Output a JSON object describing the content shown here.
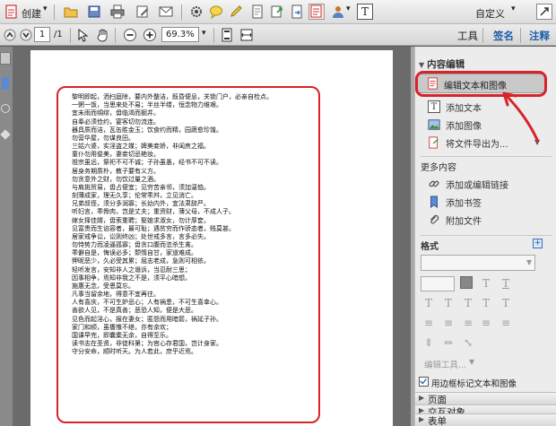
{
  "toolbar": {
    "create_label": "创建",
    "customize_label": "自定义",
    "page_current": "1",
    "page_total": "/1",
    "zoom": "69.3%",
    "tabs": [
      "工具",
      "签名",
      "注释"
    ]
  },
  "document": {
    "lines": [
      "黎明即起，洒扫庭除，要内外整洁，既昏便息，关锁门户，必亲自检点。",
      "一粥一饭，当思来处不易；半丝半缕，恒念物力维艰。",
      "宜未雨而绸缪，毋临渴而掘井。",
      "自奉必须俭约，宴客切勿流连。",
      "器具质而洁，瓦缶胜金玉；饮食约而精，园蔬愈珍馐。",
      "勿营华屋，勿谋良田。",
      "三姑六婆，实淫盗之媒；婢美妾娇，非闺房之福。",
      "童仆勿用俊美，妻妾切忌艳妆。",
      "祖宗虽远，祭祀不可不诚；子孙虽愚，经书不可不读。",
      "居身务期质朴，教子要有义方。",
      "勿贪意外之财，勿饮过量之酒。",
      "与肩挑贸易，毋占便宜；见穷苦亲邻，须加温恤。",
      "刻薄成家，理无久享；伦常乖舛，立见消亡。",
      "兄弟叔侄，须分多润寡；长幼内外，宜法肃辞严。",
      "听妇言，乖骨肉，岂是丈夫；重资财，薄父母，不成人子。",
      "嫁女择佳婿，毋索重聘；娶媳求淑女，勿计厚奁。",
      "见富贵而生谄容者，最可耻；遇贫穷而作骄态者，贱莫甚。",
      "居家戒争讼，讼则终凶；处世戒多言，言多必失。",
      "勿恃势力而凌逼孤寡；毋贪口腹而恣杀生禽。",
      "乖僻自是，悔误必多；颓惰自甘，家道难成。",
      "狎昵恶少，久必受其累；屈志老成，急则可相依。",
      "轻听发言，安知非人之谮诉，当忍耐三思；",
      "因事相争，焉知非我之不是，须平心暗想。",
      "施惠无念，受恩莫忘。",
      "凡事当留余地，得意不宜再往。",
      "人有喜庆，不可生妒忌心；人有祸患，不可生喜幸心。",
      "善欲人见，不是真善；恶恐人知，便是大恶。",
      "见色而起淫心，报在妻女；匿怨而用暗箭，祸延子孙。",
      "家门和顺，虽饔飧不继，亦有余欢；",
      "国课早完，即囊橐无余，自得至乐。",
      "读书志在圣贤，非徒科第；为官心存君国，岂计身家。",
      "守分安命，顺时听天。为人若此，庶乎近焉。"
    ]
  },
  "panel": {
    "header": "内容编辑",
    "items": [
      "编辑文本和图像",
      "添加文本",
      "添加图像",
      "将文件导出为..."
    ],
    "more_header": "更多内容",
    "more_items": [
      "添加或编辑链接",
      "添加书签",
      "附加文件"
    ],
    "format_header": "格式",
    "edit_tools": "编辑工具...",
    "checkbox_label": "用边框标记文本和图像",
    "collapsed": [
      "页面",
      "交互对象",
      "表单"
    ]
  },
  "colors": {
    "highlight_red": "#d8232a",
    "selected_bg": "#c9c9c9"
  }
}
